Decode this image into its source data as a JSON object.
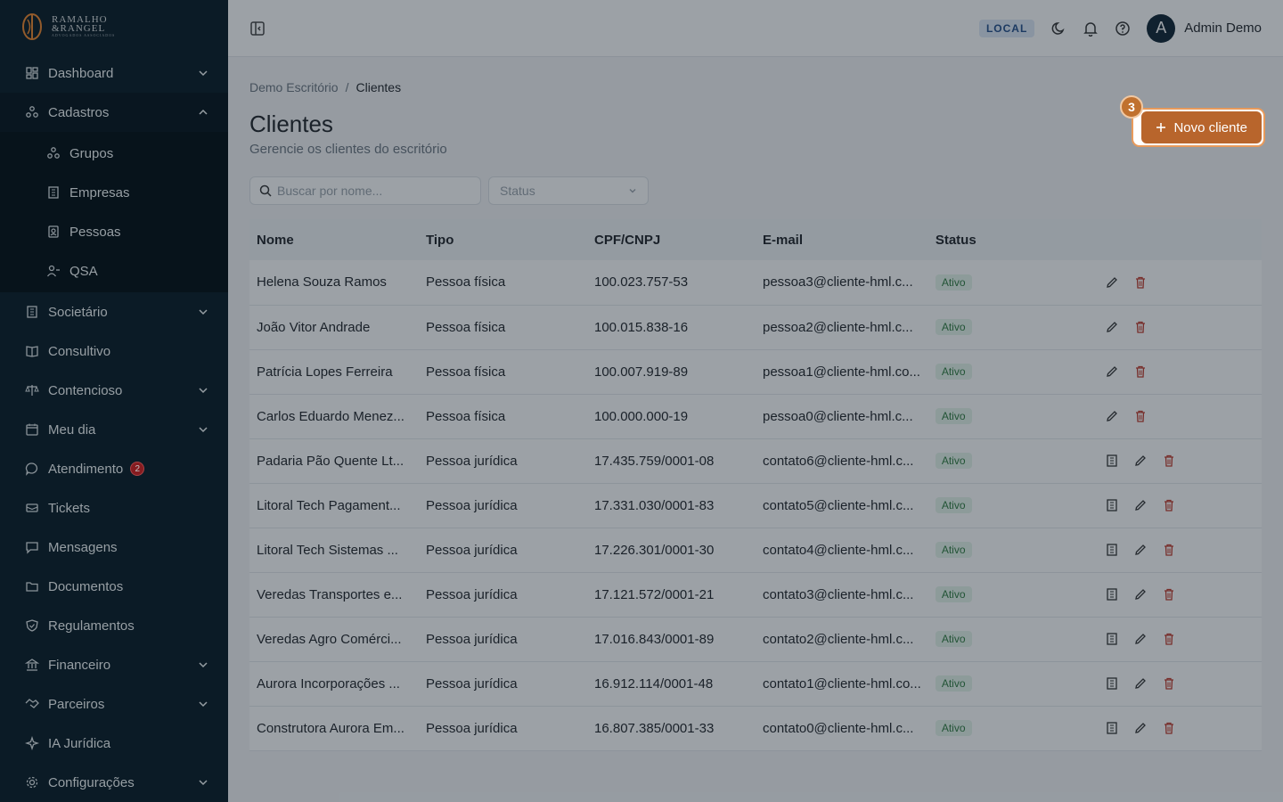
{
  "brand": {
    "logo_line1": "RAMALHO",
    "logo_line2": "&RANGEL",
    "logo_tag": "ADVOGADOS ASSOCIADOS"
  },
  "sidebar": {
    "items": [
      {
        "label": "Dashboard",
        "icon": "dashboard-icon",
        "chevron": "down"
      },
      {
        "label": "Cadastros",
        "icon": "cadastros-icon",
        "chevron": "up"
      },
      {
        "label": "Societário",
        "icon": "building-icon",
        "chevron": "down"
      },
      {
        "label": "Consultivo",
        "icon": "book-icon"
      },
      {
        "label": "Contencioso",
        "icon": "scale-icon",
        "chevron": "down"
      },
      {
        "label": "Meu dia",
        "icon": "calendar-icon",
        "chevron": "down"
      },
      {
        "label": "Atendimento",
        "icon": "chat-icon",
        "badge": "2"
      },
      {
        "label": "Tickets",
        "icon": "ticket-icon"
      },
      {
        "label": "Mensagens",
        "icon": "message-icon"
      },
      {
        "label": "Documentos",
        "icon": "folder-icon"
      },
      {
        "label": "Regulamentos",
        "icon": "shield-icon"
      },
      {
        "label": "Financeiro",
        "icon": "bank-icon",
        "chevron": "down"
      },
      {
        "label": "Parceiros",
        "icon": "handshake-icon",
        "chevron": "down"
      },
      {
        "label": "IA Jurídica",
        "icon": "sparkle-icon"
      },
      {
        "label": "Configurações",
        "icon": "gear-icon",
        "chevron": "down"
      }
    ],
    "sub_items": [
      {
        "label": "Grupos",
        "icon": "groups-icon"
      },
      {
        "label": "Empresas",
        "icon": "company-icon"
      },
      {
        "label": "Pessoas",
        "icon": "person-card-icon"
      },
      {
        "label": "QSA",
        "icon": "qsa-icon"
      }
    ]
  },
  "topbar": {
    "env": "LOCAL",
    "user_initial": "A",
    "user_name": "Admin Demo"
  },
  "main": {
    "breadcrumb": [
      "Demo Escritório",
      "/",
      "Clientes"
    ],
    "title": "Clientes",
    "subtitle": "Gerencie os clientes do escritório",
    "new_button": "Novo cliente",
    "step_number": "3",
    "search_placeholder": "Buscar por nome...",
    "status_placeholder": "Status"
  },
  "table": {
    "headers": [
      "Nome",
      "Tipo",
      "CPF/CNPJ",
      "E-mail",
      "Status"
    ],
    "rows": [
      {
        "nome": "Helena Souza Ramos",
        "tipo": "Pessoa física",
        "doc": "100.023.757-53",
        "email": "pessoa3@cliente-hml.c...",
        "status": "Ativo",
        "company": false
      },
      {
        "nome": "João Vitor Andrade",
        "tipo": "Pessoa física",
        "doc": "100.015.838-16",
        "email": "pessoa2@cliente-hml.c...",
        "status": "Ativo",
        "company": false
      },
      {
        "nome": "Patrícia Lopes Ferreira",
        "tipo": "Pessoa física",
        "doc": "100.007.919-89",
        "email": "pessoa1@cliente-hml.co...",
        "status": "Ativo",
        "company": false
      },
      {
        "nome": "Carlos Eduardo Menez...",
        "tipo": "Pessoa física",
        "doc": "100.000.000-19",
        "email": "pessoa0@cliente-hml.c...",
        "status": "Ativo",
        "company": false
      },
      {
        "nome": "Padaria Pão Quente Lt...",
        "tipo": "Pessoa jurídica",
        "doc": "17.435.759/0001-08",
        "email": "contato6@cliente-hml.c...",
        "status": "Ativo",
        "company": true
      },
      {
        "nome": "Litoral Tech Pagament...",
        "tipo": "Pessoa jurídica",
        "doc": "17.331.030/0001-83",
        "email": "contato5@cliente-hml.c...",
        "status": "Ativo",
        "company": true
      },
      {
        "nome": "Litoral Tech Sistemas ...",
        "tipo": "Pessoa jurídica",
        "doc": "17.226.301/0001-30",
        "email": "contato4@cliente-hml.c...",
        "status": "Ativo",
        "company": true
      },
      {
        "nome": "Veredas Transportes e...",
        "tipo": "Pessoa jurídica",
        "doc": "17.121.572/0001-21",
        "email": "contato3@cliente-hml.c...",
        "status": "Ativo",
        "company": true
      },
      {
        "nome": "Veredas Agro Comérci...",
        "tipo": "Pessoa jurídica",
        "doc": "17.016.843/0001-89",
        "email": "contato2@cliente-hml.c...",
        "status": "Ativo",
        "company": true
      },
      {
        "nome": "Aurora Incorporações ...",
        "tipo": "Pessoa jurídica",
        "doc": "16.912.114/0001-48",
        "email": "contato1@cliente-hml.co...",
        "status": "Ativo",
        "company": true
      },
      {
        "nome": "Construtora Aurora Em...",
        "tipo": "Pessoa jurídica",
        "doc": "16.807.385/0001-33",
        "email": "contato0@cliente-hml.c...",
        "status": "Ativo",
        "company": true
      }
    ]
  },
  "colors": {
    "sidebar_bg": "#0f2433",
    "accent": "#b8652c",
    "danger": "#c0392b",
    "success": "#2d7a3e"
  }
}
